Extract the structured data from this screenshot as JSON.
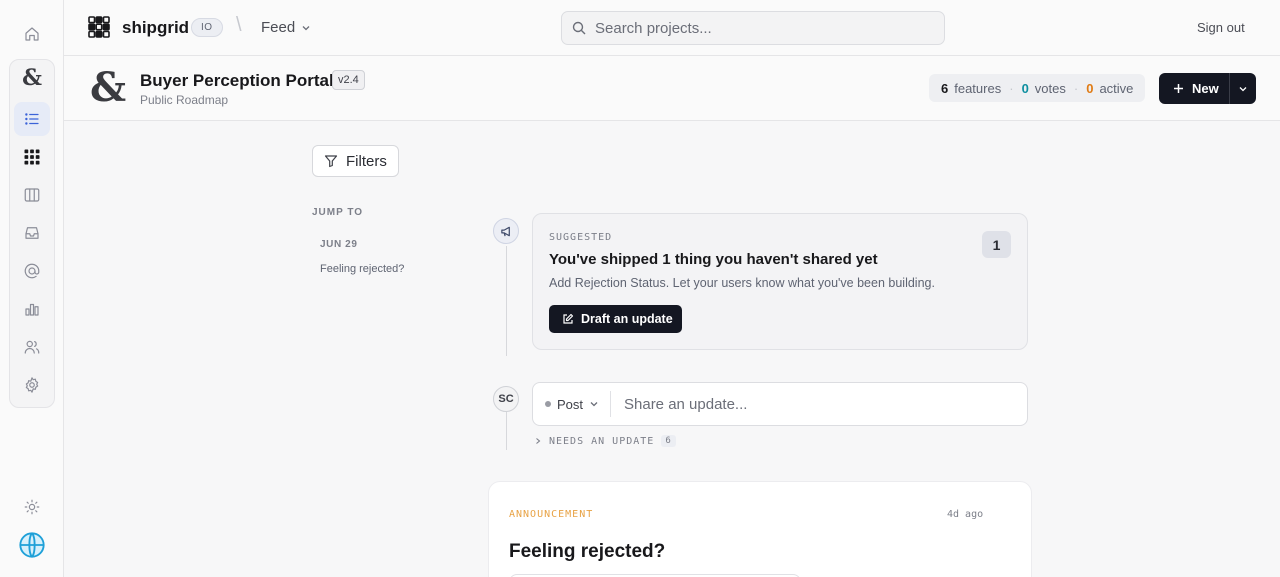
{
  "topbar": {
    "brand": "shipgrid",
    "brand_badge": "IO",
    "nav_label": "Feed",
    "search_placeholder": "Search projects...",
    "signout": "Sign out"
  },
  "project": {
    "title": "Buyer Perception Portal",
    "version": "v2.4",
    "subtitle": "Public Roadmap",
    "stats": {
      "features_count": "6",
      "features_label": "features",
      "votes_count": "0",
      "votes_label": "votes",
      "active_count": "0",
      "active_label": "active"
    },
    "new_label": "New"
  },
  "sidebar": {
    "filters_label": "Filters",
    "jump_to": "JUMP TO",
    "date": "JUN 29",
    "link": "Feeling rejected?"
  },
  "suggested": {
    "label": "SUGGESTED",
    "count": "1",
    "title": "You've shipped 1 thing you haven't shared yet",
    "description": "Add Rejection Status. Let your users know what you've been building.",
    "button": "Draft an update"
  },
  "composer": {
    "avatar": "SC",
    "post_type": "Post",
    "placeholder": "Share an update...",
    "needs_label": "NEEDS AN UPDATE",
    "needs_count": "6"
  },
  "post": {
    "kind": "ANNOUNCEMENT",
    "time": "4d ago",
    "title": "Feeling rejected?"
  },
  "colors": {
    "accent": "#3b63d8",
    "dark_button": "#141722",
    "stat_features": "#18181b",
    "stat_votes": "#0e8fa0",
    "stat_active": "#e07b14",
    "announcement": "#e8a244"
  },
  "rail_icons": [
    "home-icon",
    "project-logo",
    "list-icon",
    "grid-logo-icon",
    "board-icon",
    "inbox-icon",
    "at-icon",
    "chart-icon",
    "users-icon",
    "gear-icon",
    "sun-icon",
    "globe-avatar-icon"
  ]
}
